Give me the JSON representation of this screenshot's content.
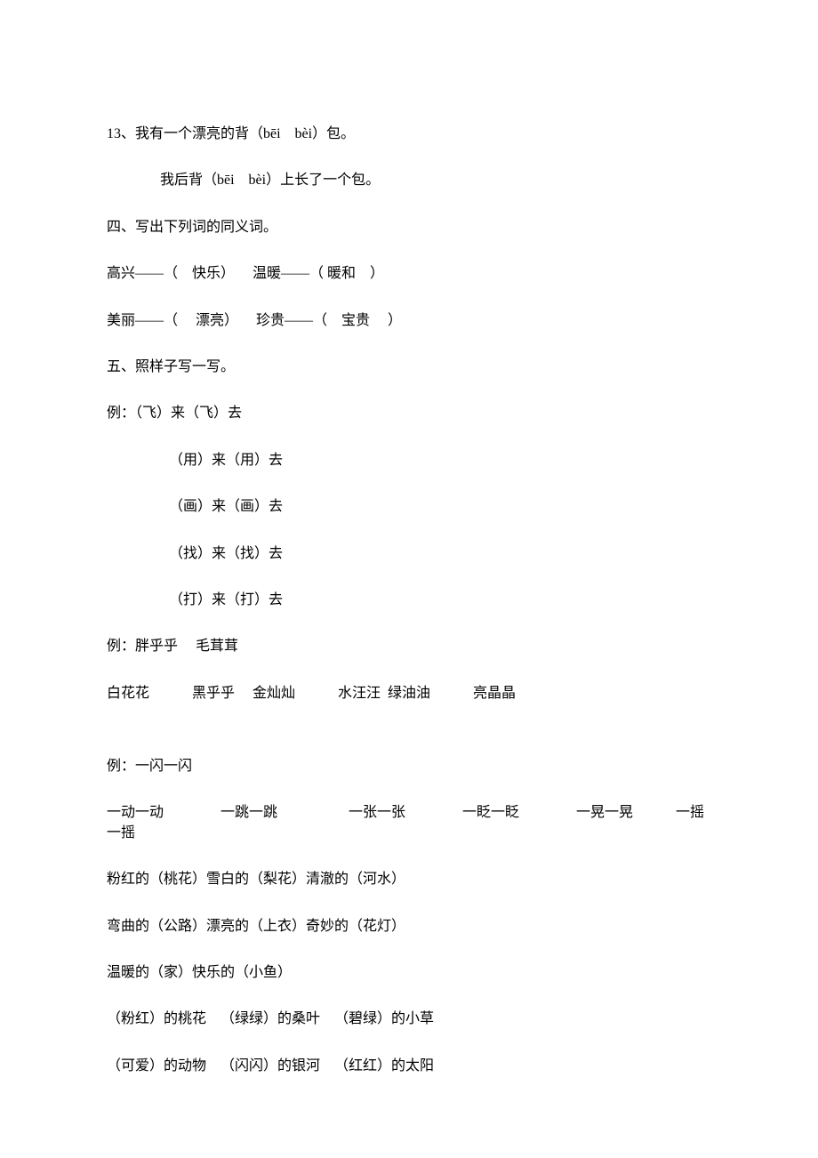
{
  "q13_line1": "13、我有一个漂亮的背（bēi bèi）包。",
  "q13_line2": "我后背（bēi bèi）上长了一个包。",
  "q4_title": "四、写出下列词的同义词。",
  "q4_line1": "高兴——（ 快乐）  温暖——（ 暖和 ）",
  "q4_line2": "美丽——（  漂亮）  珍贵——（ 宝贵  ）",
  "q5_title": "五、照样子写一写。",
  "q5_ex1": "例：（飞）来（飞）去",
  "q5_a1": "（用）来（用）去",
  "q5_a2": "（画）来（画）去",
  "q5_a3": "（找）来（找）去",
  "q5_a4": "（打）来（打）去",
  "q5_ex2": "例：胖乎乎  毛茸茸",
  "q5_b1": "白花花   黑乎乎  金灿灿   水汪汪 绿油油   亮晶晶",
  "q5_ex3": "例：一闪一闪",
  "q5_c1": "一动一动    一跳一跳     一张一张    一眨一眨    一晃一晃   一摇一摇",
  "q5_d1": "粉红的（桃花）雪白的（梨花）清澈的（河水）",
  "q5_d2": "弯曲的（公路）漂亮的（上衣）奇妙的（花灯）",
  "q5_d3": "温暖的（家）快乐的（小鱼）",
  "q5_e1": "（粉红）的桃花 （绿绿）的桑叶 （碧绿）的小草",
  "q5_e2": "（可爱）的动物 （闪闪）的银河 （红红）的太阳"
}
